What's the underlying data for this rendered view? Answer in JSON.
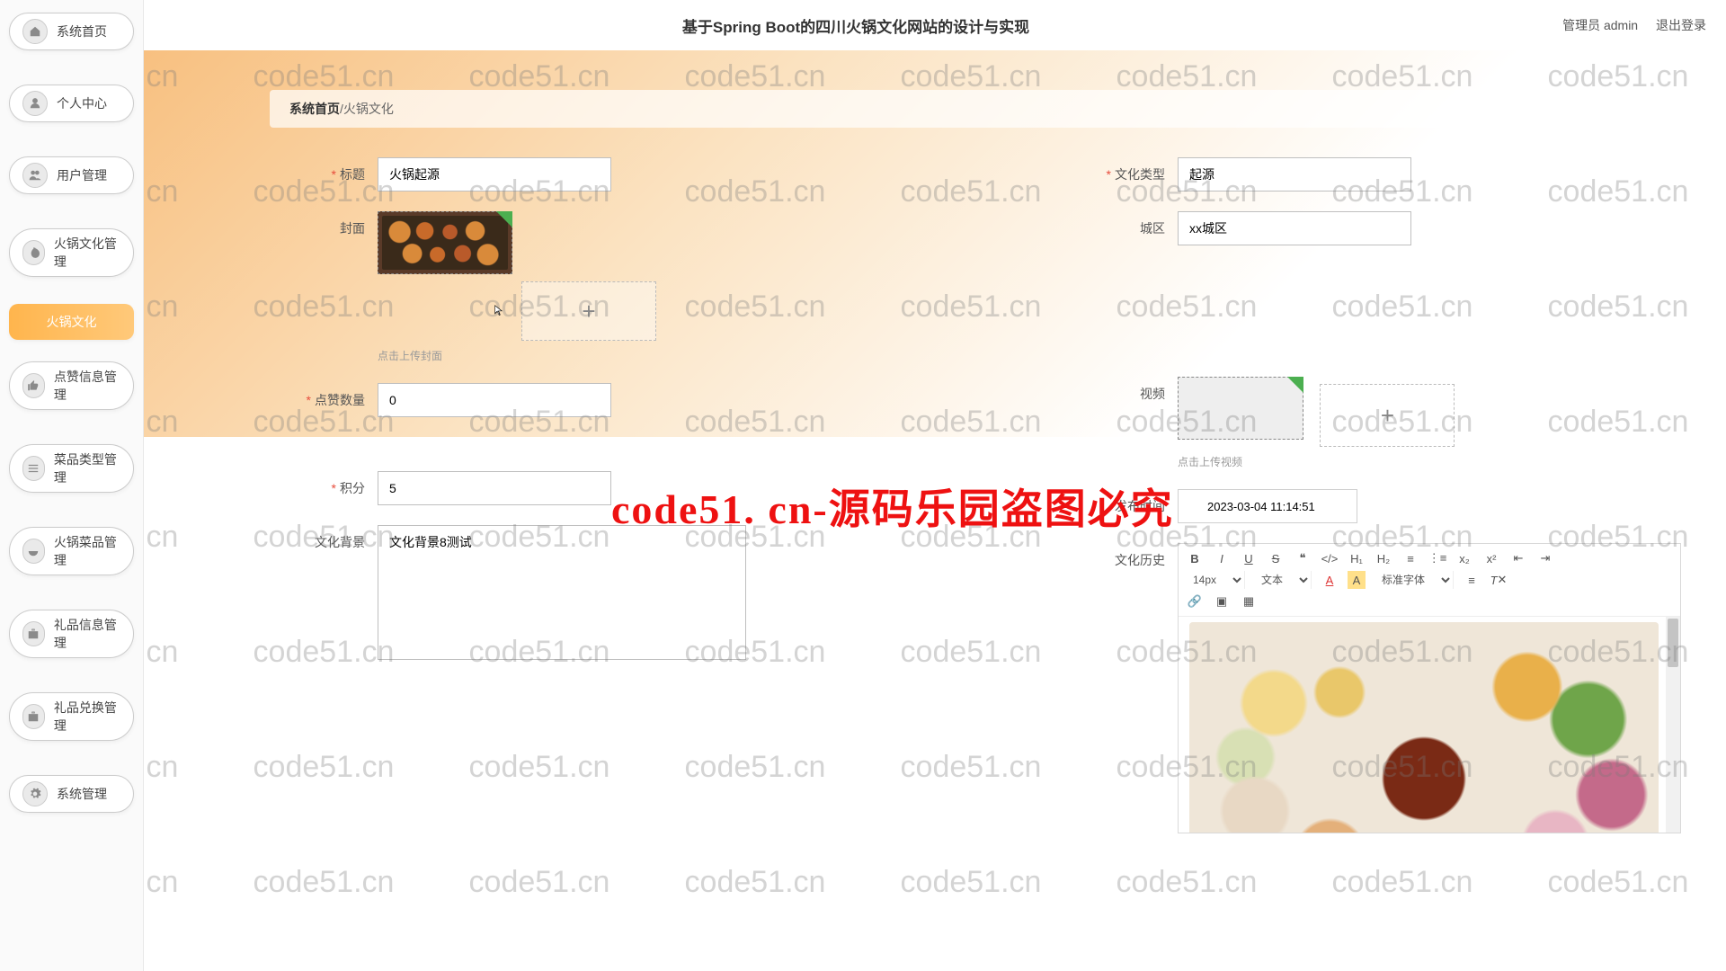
{
  "header": {
    "title": "基于Spring Boot的四川火锅文化网站的设计与实现",
    "role_user": "管理员 admin",
    "logout": "退出登录"
  },
  "sidebar": {
    "items": [
      {
        "label": "系统首页",
        "icon": "home"
      },
      {
        "label": "个人中心",
        "icon": "user"
      },
      {
        "label": "用户管理",
        "icon": "users"
      },
      {
        "label": "火锅文化管理",
        "icon": "fire"
      },
      {
        "label": "火锅文化",
        "sub": true
      },
      {
        "label": "点赞信息管理",
        "icon": "like"
      },
      {
        "label": "菜品类型管理",
        "icon": "list"
      },
      {
        "label": "火锅菜品管理",
        "icon": "bowl"
      },
      {
        "label": "礼品信息管理",
        "icon": "gift"
      },
      {
        "label": "礼品兑换管理",
        "icon": "gift"
      },
      {
        "label": "系统管理",
        "icon": "gear"
      }
    ]
  },
  "breadcrumb": {
    "root": "系统首页",
    "sep": " / ",
    "current": "火锅文化"
  },
  "form": {
    "title_label": "标题",
    "title_value": "火锅起源",
    "type_label": "文化类型",
    "type_value": "起源",
    "cover_label": "封面",
    "cover_hint": "点击上传封面",
    "district_label": "城区",
    "district_value": "xx城区",
    "likes_label": "点赞数量",
    "likes_value": "0",
    "video_label": "视频",
    "video_hint": "点击上传视频",
    "points_label": "积分",
    "points_value": "5",
    "publish_label": "发布时间",
    "publish_value": "2023-03-04 11:14:51",
    "bg_label": "文化背景",
    "bg_value": "文化背景8测试",
    "history_label": "文化历史"
  },
  "editor_toolbar": {
    "size": "14px",
    "block": "文本",
    "font": "标准字体"
  },
  "watermark": {
    "text": "code51.cn",
    "big": "code51. cn-源码乐园盗图必究"
  }
}
